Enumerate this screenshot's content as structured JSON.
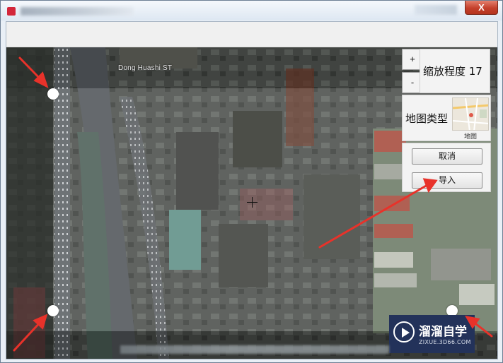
{
  "window": {
    "title": "",
    "close_label": "X"
  },
  "map": {
    "street_label": "Dong Huashi ST"
  },
  "controls": {
    "zoom_in_label": "+",
    "zoom_out_label": "-",
    "zoom_text": "缩放程度 17",
    "map_type_label": "地图类型",
    "map_type_thumb_label": "地图",
    "cancel_label": "取消",
    "import_label": "导入"
  },
  "watermark": {
    "title": "溜溜自学",
    "url": "ZIXUE.3D66.COM"
  },
  "colors": {
    "annotation_arrow": "#e8322a",
    "watermark_bg": "#23325a",
    "selection_handle": "#ffffff"
  }
}
